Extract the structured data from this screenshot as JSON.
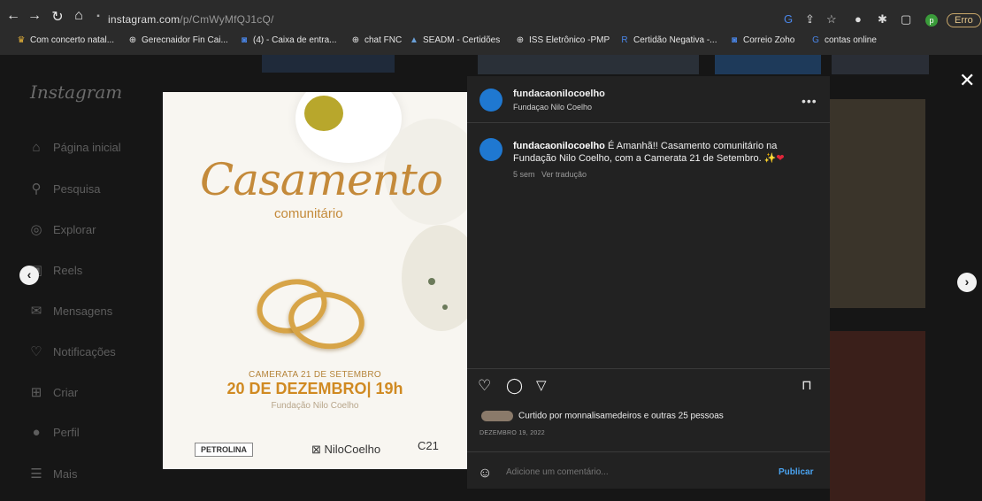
{
  "browser": {
    "url_host": "instagram.com",
    "url_path": "/p/CmWyMfQJ1cQ/",
    "error_badge": "Erro",
    "profile_initial": "p",
    "bookmarks": [
      {
        "label": "Com concerto natal...",
        "icon": "crown-icon"
      },
      {
        "label": "Gerecnaidor Fin Cai...",
        "icon": "globe-icon"
      },
      {
        "label": "(4) - Caixa de entra...",
        "icon": "mail-icon"
      },
      {
        "label": "chat FNC",
        "icon": "globe-icon"
      },
      {
        "label": "SEADM - Certidões",
        "icon": "building-icon"
      },
      {
        "label": "ISS Eletrônico -PMP",
        "icon": "globe-icon"
      },
      {
        "label": "Certidão Negativa -...",
        "icon": "r-icon"
      },
      {
        "label": "Correio Zoho",
        "icon": "mail-icon"
      },
      {
        "label": "contas online",
        "icon": "google-icon"
      }
    ]
  },
  "sidebar": {
    "logo": "Instagram",
    "items": [
      {
        "label": "Página inicial",
        "icon": "home-icon"
      },
      {
        "label": "Pesquisa",
        "icon": "search-icon"
      },
      {
        "label": "Explorar",
        "icon": "compass-icon"
      },
      {
        "label": "Reels",
        "icon": "reels-icon"
      },
      {
        "label": "Mensagens",
        "icon": "messenger-icon"
      },
      {
        "label": "Notificações",
        "icon": "heart-icon"
      },
      {
        "label": "Criar",
        "icon": "plus-icon"
      },
      {
        "label": "Perfil",
        "icon": "profile-icon"
      },
      {
        "label": "Mais",
        "icon": "menu-icon"
      }
    ]
  },
  "post_image": {
    "title": "Casamento",
    "subtitle": "comunitário",
    "camerata": "CAMERATA 21 DE SETEMBRO",
    "date": "20 DE DEZEMBRO| 19h",
    "venue": "Fundação Nilo Coelho",
    "logo_petrolina": "PETROLINA",
    "logo_nilo": "NiloCoelho",
    "logo_c21": "C21"
  },
  "post": {
    "username": "fundacaonilocoelho",
    "account_name": "Fundaçao Nilo Coelho",
    "more": "•••",
    "caption_user": "fundacaonilocoelho",
    "caption_text": "É Amanhã!! Casamento comunitário na Fundação Nilo Coelho, com a Camerata 21 de Setembro.",
    "caption_emoji": "✨",
    "caption_heart": "❤",
    "time_ago": "5 sem",
    "translate": "Ver tradução",
    "likes_text": "Curtido por monnalisamedeiros e outras 25 pessoas",
    "post_date": "DEZEMBRO 19, 2022",
    "comment_placeholder": "Adicione um comentário...",
    "publish": "Publicar"
  },
  "controls": {
    "close": "✕",
    "prev": "‹",
    "next": "›"
  }
}
